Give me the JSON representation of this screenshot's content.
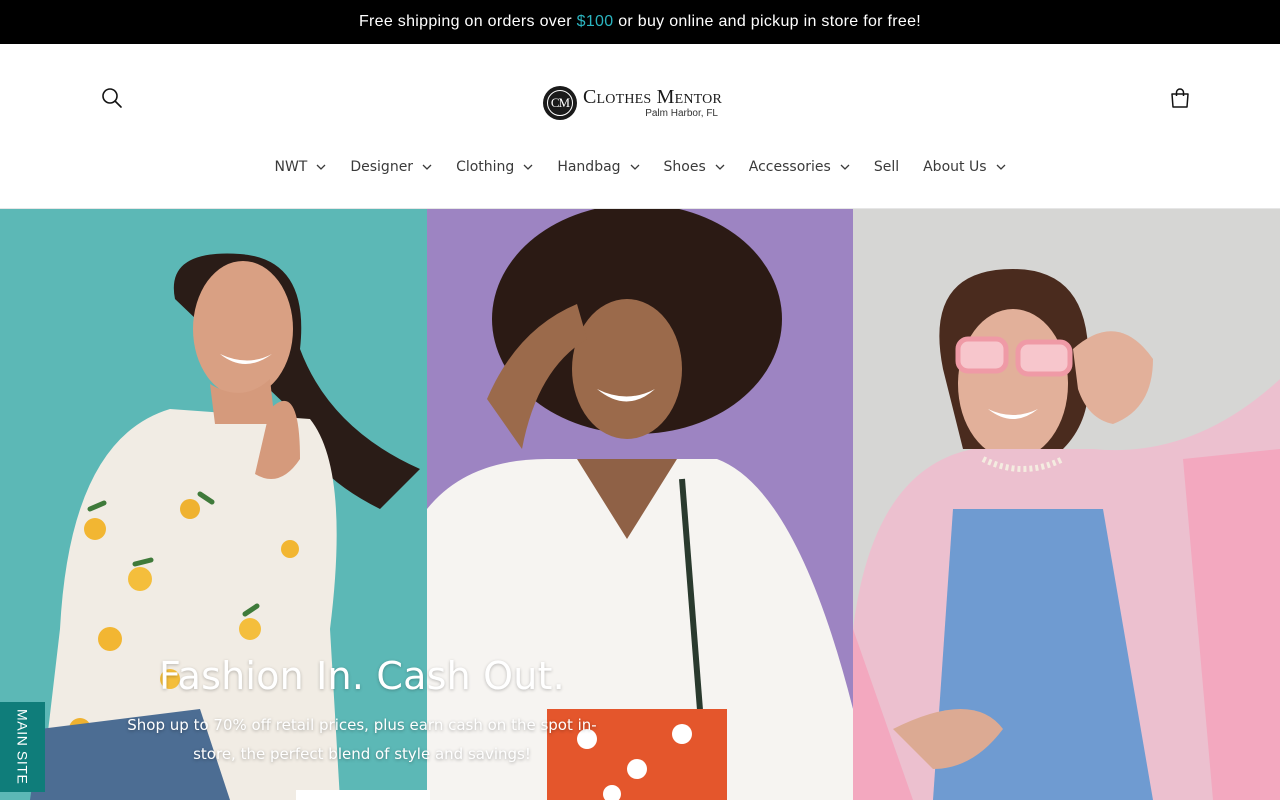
{
  "announcement": {
    "prefix": "Free shipping on orders over ",
    "amount": "$100",
    "suffix": " or buy online and pickup in store for free!",
    "accent_color": "#2bb5c0"
  },
  "header": {
    "search_icon": "search-icon",
    "cart_icon": "bag-icon",
    "logo": {
      "monogram": "CM",
      "name": "Clothes Mentor",
      "location": "Palm Harbor, FL"
    }
  },
  "nav": {
    "items": [
      {
        "label": "NWT",
        "dropdown": true
      },
      {
        "label": "Designer",
        "dropdown": true
      },
      {
        "label": "Clothing",
        "dropdown": true
      },
      {
        "label": "Handbag",
        "dropdown": true
      },
      {
        "label": "Shoes",
        "dropdown": true
      },
      {
        "label": "Accessories",
        "dropdown": true
      },
      {
        "label": "Sell",
        "dropdown": false
      },
      {
        "label": "About Us",
        "dropdown": true
      }
    ]
  },
  "hero": {
    "title": "Fashion In. Cash Out.",
    "subtitle": "Shop up to 70% off retail prices, plus earn cash on the spot in-store, the perfect blend of style and savings!",
    "panel_colors": [
      "#5cb8b6",
      "#9d84c2",
      "#d6d6d4"
    ]
  },
  "side_tab": {
    "label": "MAIN SITE",
    "color": "#0f7d7a"
  }
}
